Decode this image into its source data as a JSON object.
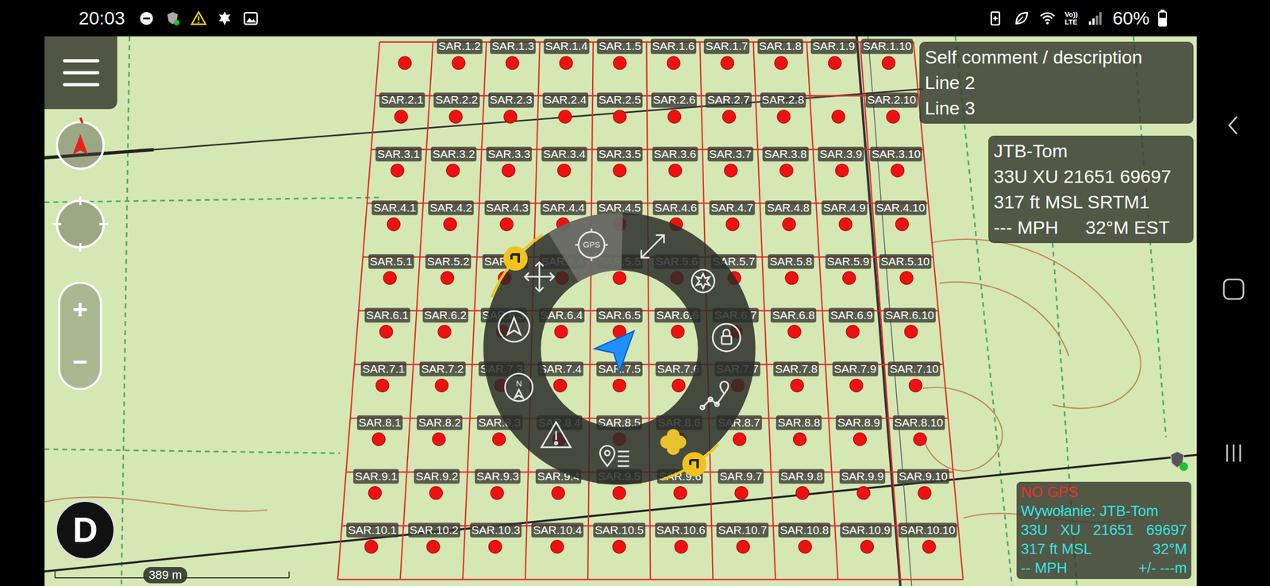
{
  "status_bar": {
    "time": "20:03",
    "volte": [
      "Vo))",
      "LTE"
    ],
    "battery": "60%",
    "battery_level": 0.6
  },
  "map": {
    "grid": [
      [
        "",
        "SAR.1.2",
        "SAR.1.3",
        "SAR.1.4",
        "SAR.1.5",
        "SAR.1.6",
        "SAR.1.7",
        "SAR.1.8",
        "SAR.1.9",
        "SAR.1.10"
      ],
      [
        "SAR.2.1",
        "SAR.2.2",
        "SAR.2.3",
        "SAR.2.4",
        "SAR.2.5",
        "SAR.2.6",
        "SAR.2.7",
        "SAR.2.8",
        "",
        "SAR.2.10"
      ],
      [
        "SAR.3.1",
        "SAR.3.2",
        "SAR.3.3",
        "SAR.3.4",
        "SAR.3.5",
        "SAR.3.6",
        "SAR.3.7",
        "SAR.3.8",
        "SAR.3.9",
        "SAR.3.10"
      ],
      [
        "SAR.4.1",
        "SAR.4.2",
        "SAR.4.3",
        "SAR.4.4",
        "SAR.4.5",
        "SAR.4.6",
        "SAR.4.7",
        "SAR.4.8",
        "SAR.4.9",
        "SAR.4.10"
      ],
      [
        "SAR.5.1",
        "SAR.5.2",
        "SAR.5.3",
        "SAR.5.4",
        "SAR.5.5",
        "SAR.5.6",
        "SAR.5.7",
        "SAR.5.8",
        "SAR.5.9",
        "SAR.5.10"
      ],
      [
        "SAR.6.1",
        "SAR.6.2",
        "SAR.6.3",
        "SAR.6.4",
        "SAR.6.5",
        "SAR.6.6",
        "SAR.6.7",
        "SAR.6.8",
        "SAR.6.9",
        "SAR.6.10"
      ],
      [
        "SAR.7.1",
        "SAR.7.2",
        "SAR.7.3",
        "SAR.7.4",
        "SAR.7.5",
        "SAR.7.6",
        "SAR.7.7",
        "SAR.7.8",
        "SAR.7.9",
        "SAR.7.10"
      ],
      [
        "SAR.8.1",
        "SAR.8.2",
        "SAR.8.3",
        "SAR.8.4",
        "SAR.8.5",
        "SAR.8.6",
        "SAR.8.7",
        "SAR.8.8",
        "SAR.8.9",
        "SAR.8.10"
      ],
      [
        "SAR.9.1",
        "SAR.9.2",
        "SAR.9.3",
        "SAR.9.4",
        "SAR.9.5",
        "SAR.9.6",
        "SAR.9.7",
        "SAR.9.8",
        "SAR.9.9",
        "SAR.9.10"
      ],
      [
        "SAR.10.1",
        "SAR.10.2",
        "SAR.10.3",
        "SAR.10.4",
        "SAR.10.5",
        "SAR.10.6",
        "SAR.10.7",
        "SAR.10.8",
        "SAR.10.9",
        "SAR.10.10"
      ]
    ],
    "scale": "389 m"
  },
  "controls": {
    "zoom_in": "+",
    "zoom_out": "−",
    "d_button": "D"
  },
  "comment_panel": {
    "lines": [
      [
        "Self comment / description"
      ],
      [
        "Line 2"
      ],
      [
        "Line 3"
      ]
    ]
  },
  "self_panel": {
    "lines": [
      [
        "JTB-Tom"
      ],
      [
        "33U XU 21651 69697"
      ],
      [
        "317 ft MSL SRTM1"
      ],
      [
        "--- MPH",
        "32°M EST"
      ]
    ]
  },
  "gps_panel": {
    "lines": [
      {
        "parts": [
          "NO GPS"
        ],
        "color": "#ff2a2a"
      },
      {
        "parts": [
          "Wywołanie: JTB-Tom"
        ],
        "color": "#35e3e3"
      },
      {
        "parts": [
          "33U",
          "XU",
          "21651",
          "69697"
        ],
        "color": "#35e3e3"
      },
      {
        "parts": [
          "317 ft MSL",
          "32°M"
        ],
        "color": "#35e3e3"
      },
      {
        "parts": [
          "-- MPH",
          "+/- ---m"
        ],
        "color": "#35e3e3"
      }
    ]
  },
  "radial_menu": {
    "items": [
      {
        "kind": "move",
        "selected": false
      },
      {
        "kind": "gps",
        "label": "GPS",
        "selected": true
      },
      {
        "kind": "resize",
        "selected": false
      },
      {
        "kind": "badge",
        "selected": false
      },
      {
        "kind": "lock",
        "selected": false
      },
      {
        "kind": "route",
        "selected": false
      },
      {
        "kind": "clover",
        "selected": false
      },
      {
        "kind": "pinlist",
        "selected": false
      },
      {
        "kind": "warning",
        "selected": false
      },
      {
        "kind": "north",
        "label": "N",
        "selected": false
      },
      {
        "kind": "compass",
        "selected": false
      }
    ]
  }
}
